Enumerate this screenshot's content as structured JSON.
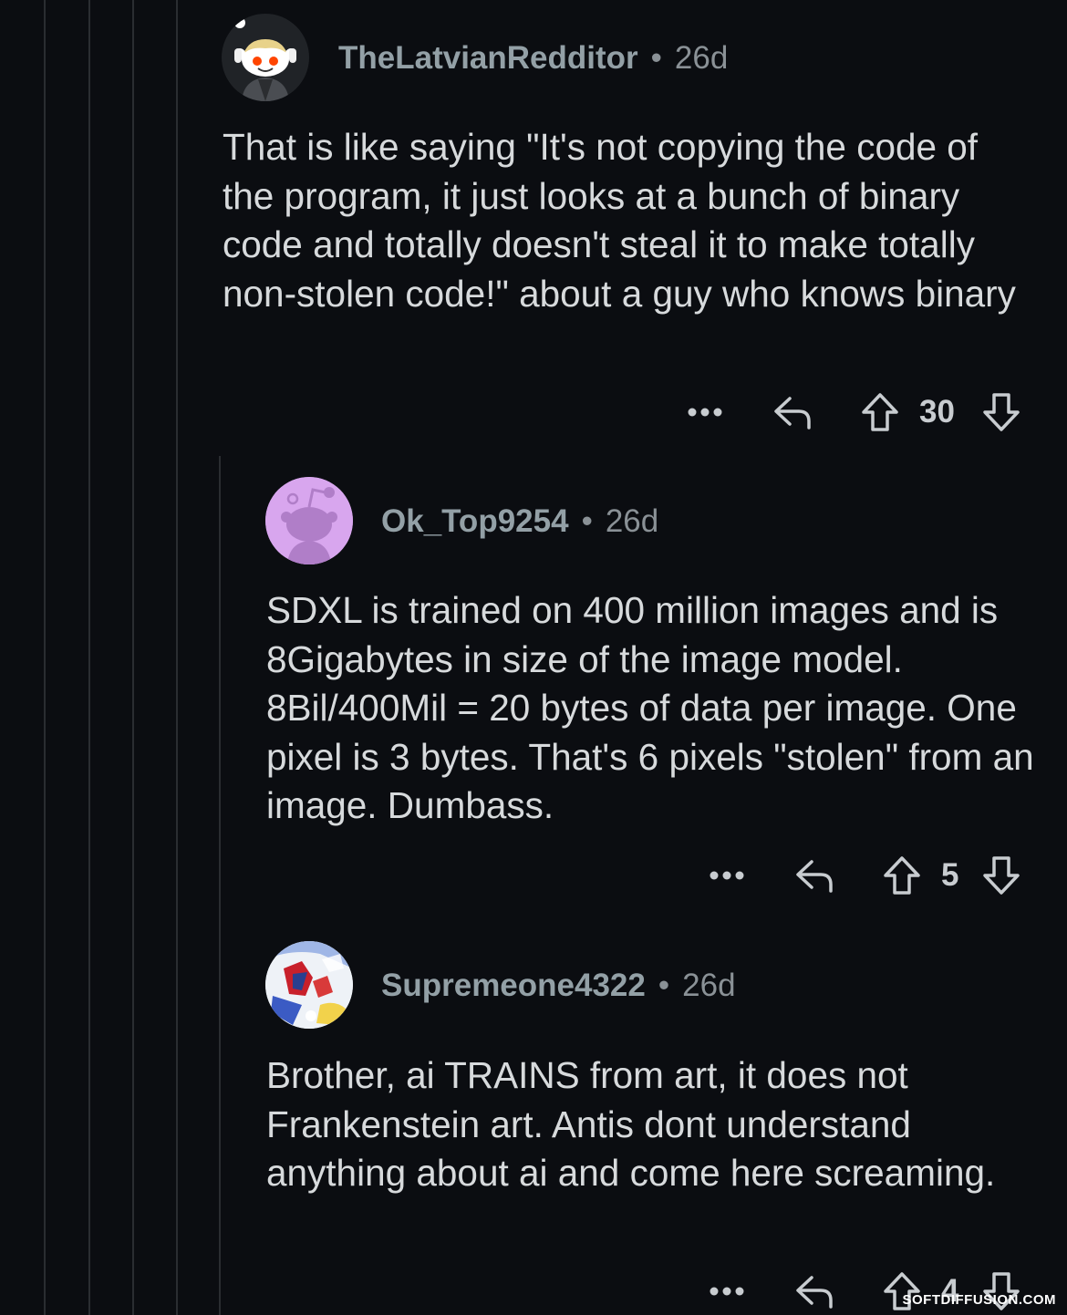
{
  "comments": [
    {
      "username": "TheLatvianRedditor",
      "separator": "•",
      "age": "26d",
      "avatar_icon": "snoo-avatar-headphones-icon",
      "body": "That is like saying \"It's not copying the code of the program, it just looks at a bunch of binary code and totally doesn't steal it to make totally non-stolen code!\" about a guy who knows binary",
      "more_icon": "more-options-icon",
      "reply_icon": "reply-icon",
      "upvote_icon": "upvote-icon",
      "score": "30",
      "downvote_icon": "downvote-icon"
    },
    {
      "username": "Ok_Top9254",
      "separator": "•",
      "age": "26d",
      "avatar_icon": "default-snoo-avatar-icon",
      "body": "SDXL is trained on 400 million images and is 8Gigabytes in size of the image model. 8Bil/400Mil = 20 bytes of data per image. One pixel is 3 bytes. That's 6 pixels \"stolen\" from an image. Dumbass.",
      "more_icon": "more-options-icon",
      "reply_icon": "reply-icon",
      "upvote_icon": "upvote-icon",
      "score": "5",
      "downvote_icon": "downvote-icon"
    },
    {
      "username": "Supremeone4322",
      "separator": "•",
      "age": "26d",
      "avatar_icon": "artwork-avatar-icon",
      "body": "Brother, ai TRAINS from art, it does not Frankenstein art. Antis dont understand anything about ai and come here screaming.",
      "more_icon": "more-options-icon",
      "reply_icon": "reply-icon",
      "upvote_icon": "upvote-icon",
      "score": "4",
      "downvote_icon": "downvote-icon"
    }
  ],
  "watermark": "SOFTDIFFUSION.COM",
  "colors": {
    "background": "#0b0d11",
    "thread_line": "#2a2d31",
    "username": "#93a0a6",
    "meta": "#8a9196",
    "body_text": "#d7dadc",
    "purple_avatar": "#d8a6ee"
  }
}
